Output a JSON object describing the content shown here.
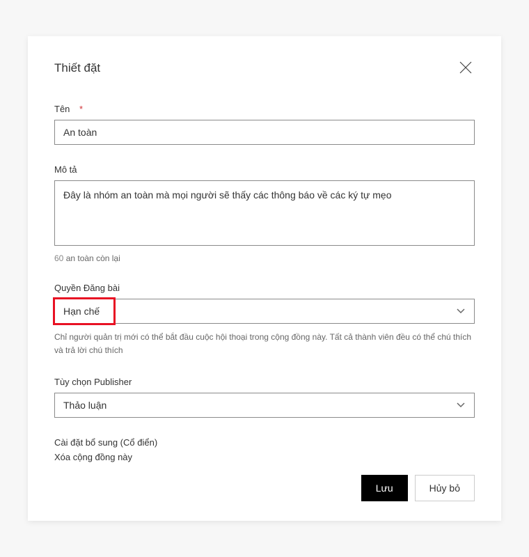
{
  "modal": {
    "title": "Thiết đặt"
  },
  "fields": {
    "name": {
      "label": "Tên",
      "required_mark": "*",
      "value": "An toàn"
    },
    "description": {
      "label": "Mô tả",
      "value": "Đây là nhóm an toàn mà mọi người sẽ thấy các thông báo về các ký tự mẹo",
      "char_count_number": "60",
      "char_count_text": " an toàn còn lại"
    },
    "posting_rights": {
      "label": "Quyền Đăng bài",
      "selected": "Hạn chế",
      "helper": "Chỉ người quản trị mới có thể bắt đầu cuộc hội thoại trong cộng đồng này. Tất cả thành viên đều có thể chú thích và trả lời chú thích"
    },
    "publisher_options": {
      "label": "Tùy chọn Publisher",
      "selected": "Thảo luận"
    }
  },
  "links": {
    "additional_settings": "Cài đặt bổ sung (Cổ điển)",
    "delete_community": "Xóa cộng đồng này"
  },
  "buttons": {
    "save": "Lưu",
    "cancel": "Hủy bỏ"
  }
}
